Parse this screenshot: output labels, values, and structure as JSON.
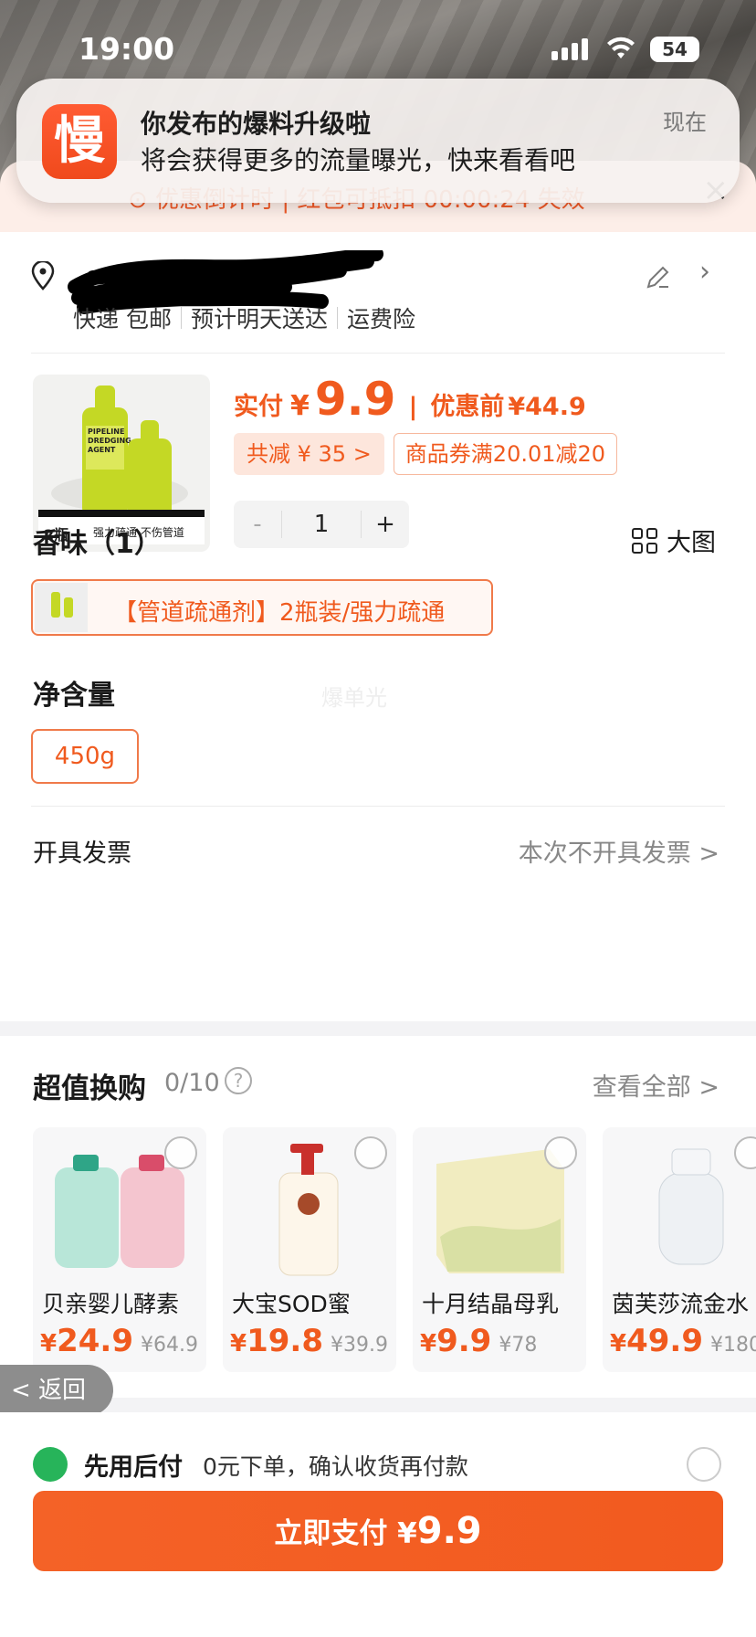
{
  "status_bar": {
    "time": "19:00",
    "battery": "54"
  },
  "notification": {
    "app_icon_char": "慢",
    "title": "你发布的爆料升级啦",
    "body": "将会获得更多的流量曝光，快来看看吧",
    "time": "现在"
  },
  "promo_strip": {
    "text": "⊙ 优惠倒计时 | 红包可抵扣 00:00:24 失效",
    "close": "×"
  },
  "address": {
    "shipping": [
      "快递 包邮",
      "预计明天送达",
      "运费险"
    ]
  },
  "product": {
    "image_caption_count": "2瓶",
    "image_caption_text": "强力疏通 不伤管道",
    "bottle_label": "PIPELINE DREDGING AGENT",
    "price_label": "实付",
    "currency": "¥",
    "price": "9.9",
    "before_label": "优惠前",
    "before_price": "¥44.9",
    "discount_tag": "共减 ¥ 35 >",
    "coupon_tag": "商品券满20.01减20",
    "qty_minus": "-",
    "quantity": "1",
    "qty_plus": "+"
  },
  "scent": {
    "title": "香味（1）",
    "big_view": "大图",
    "option": "【管道疏通剂】2瓶装/强力疏通"
  },
  "watermark": "爆单光",
  "volume": {
    "title": "净含量",
    "option": "450g"
  },
  "invoice": {
    "label": "开具发票",
    "value": "本次不开具发票 >"
  },
  "swap": {
    "title": "超值换购",
    "count": "0/10",
    "help": "?",
    "see_all": "查看全部 >",
    "items": [
      {
        "name": "贝亲婴儿酵素",
        "currency": "¥",
        "price": "24.9",
        "was": "¥64.9"
      },
      {
        "name": "大宝SOD蜜",
        "currency": "¥",
        "price": "19.8",
        "was": "¥39.9"
      },
      {
        "name": "十月结晶母乳",
        "currency": "¥",
        "price": "9.9",
        "was": "¥78"
      },
      {
        "name": "茵芙莎流金水",
        "currency": "¥",
        "price": "49.9",
        "was": "¥180"
      }
    ]
  },
  "back_button": "< 返回",
  "pay_later": {
    "title": "先用后付",
    "desc": "0元下单，确认收货再付款"
  },
  "pay_button": {
    "label": "立即支付 ¥",
    "amount": "9.9"
  },
  "colors": {
    "accent": "#f05a1e",
    "button": "#f46227",
    "pay_later_green": "#27b45a"
  }
}
